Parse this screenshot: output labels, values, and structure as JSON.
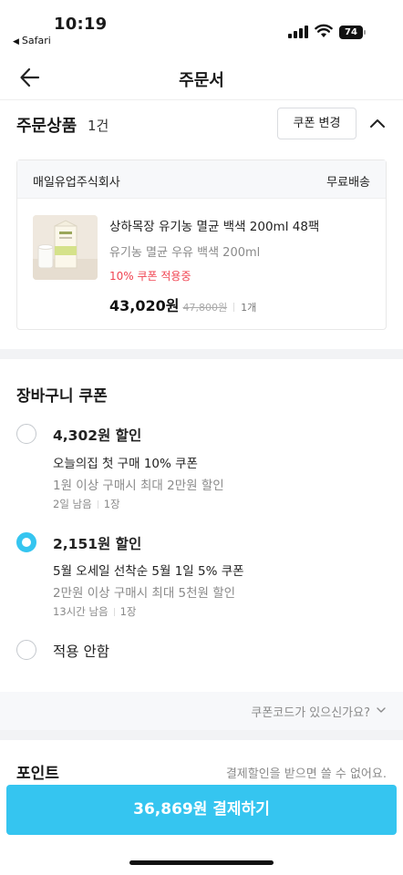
{
  "status_bar": {
    "time": "10:19",
    "back_app": "Safari",
    "battery": "74"
  },
  "nav": {
    "title": "주문서"
  },
  "order": {
    "label": "주문상품",
    "count": "1건",
    "coupon_change_label": "쿠폰 변경",
    "seller": "매일유업주식회사",
    "shipping": "무료배송",
    "product": {
      "name": "상하목장 유기농 멸균 백색 200ml 48팩",
      "option": "유기농 멸균 우유 백색 200ml",
      "coupon_status": "10% 쿠폰 적용중",
      "price": "43,020원",
      "original_price": "47,800원",
      "quantity": "1개"
    }
  },
  "cart_coupon": {
    "title": "장바구니 쿠폰",
    "options": [
      {
        "discount": "4,302원 할인",
        "name": "오늘의집 첫 구매 10% 쿠폰",
        "condition": "1원 이상 구매시 최대 2만원 할인",
        "remaining": "2일 남음",
        "count": "1장",
        "selected": false
      },
      {
        "discount": "2,151원 할인",
        "name": "5월 오세일 선착순 5월 1일 5% 쿠폰",
        "condition": "2만원 이상 구매시 최대 5천원 할인",
        "remaining": "13시간 남음",
        "count": "1장",
        "selected": true
      }
    ],
    "none_label": "적용 안함",
    "coupon_code_prompt": "쿠폰코드가 있으신가요?"
  },
  "points": {
    "title": "포인트",
    "note": "결제할인을 받으면 쓸 수 없어요."
  },
  "pay_button_label": "36,869원 결제하기",
  "colors": {
    "accent": "#35c5f0",
    "coupon_red": "#f04452",
    "muted_text": "#8a8a8a"
  }
}
